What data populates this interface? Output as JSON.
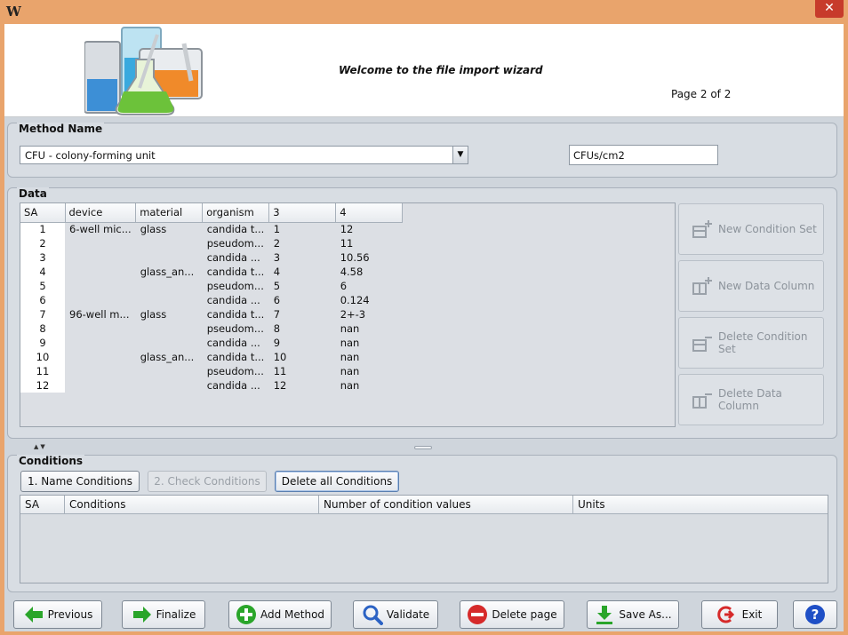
{
  "window": {
    "app_icon_glyph": "W",
    "close_glyph": "✕"
  },
  "header": {
    "welcome": "Welcome to the file import wizard",
    "page_indicator": "Page 2 of 2"
  },
  "method": {
    "group_title": "Method Name",
    "selected": "CFU - colony-forming unit",
    "unit_value": "CFUs/cm2"
  },
  "data": {
    "group_title": "Data",
    "columns": [
      "SA",
      "device",
      "material",
      "organism",
      "3",
      "4"
    ],
    "rows": [
      [
        "1",
        "6-well mic...",
        "glass",
        "candida t...",
        "1",
        "12"
      ],
      [
        "2",
        "",
        "",
        "pseudom...",
        "2",
        "11"
      ],
      [
        "3",
        "",
        "",
        "candida ...",
        "3",
        "10.56"
      ],
      [
        "4",
        "",
        "glass_an...",
        "candida t...",
        "4",
        "4.58"
      ],
      [
        "5",
        "",
        "",
        "pseudom...",
        "5",
        "6"
      ],
      [
        "6",
        "",
        "",
        "candida ...",
        "6",
        "0.124"
      ],
      [
        "7",
        "96-well m...",
        "glass",
        "candida t...",
        "7",
        "2+-3"
      ],
      [
        "8",
        "",
        "",
        "pseudom...",
        "8",
        "nan"
      ],
      [
        "9",
        "",
        "",
        "candida ...",
        "9",
        "nan"
      ],
      [
        "10",
        "",
        "glass_an...",
        "candida t...",
        "10",
        "nan"
      ],
      [
        "11",
        "",
        "",
        "pseudom...",
        "11",
        "nan"
      ],
      [
        "12",
        "",
        "",
        "candida ...",
        "12",
        "nan"
      ]
    ],
    "side_buttons": {
      "new_condition_set": "New Condition Set",
      "new_data_column": "New Data Column",
      "delete_condition_set": "Delete Condition Set",
      "delete_data_column": "Delete Data Column"
    }
  },
  "conditions": {
    "group_title": "Conditions",
    "name_conditions": "1. Name Conditions",
    "check_conditions": "2. Check Conditions",
    "delete_all": "Delete all Conditions",
    "columns": [
      "SA",
      "Conditions",
      "Number of condition values",
      "Units"
    ]
  },
  "footer": {
    "previous": "Previous",
    "finalize": "Finalize",
    "add_method": "Add Method",
    "validate": "Validate",
    "delete_page": "Delete page",
    "save_as": "Save As...",
    "exit": "Exit",
    "help": "?"
  },
  "colors": {
    "window_frame": "#e9a46c",
    "close_button": "#c73b2b",
    "arrow_green": "#2aa52a",
    "validate_blue": "#2b62c4",
    "delete_red": "#d62a2a",
    "help_blue": "#1f4fc6"
  }
}
